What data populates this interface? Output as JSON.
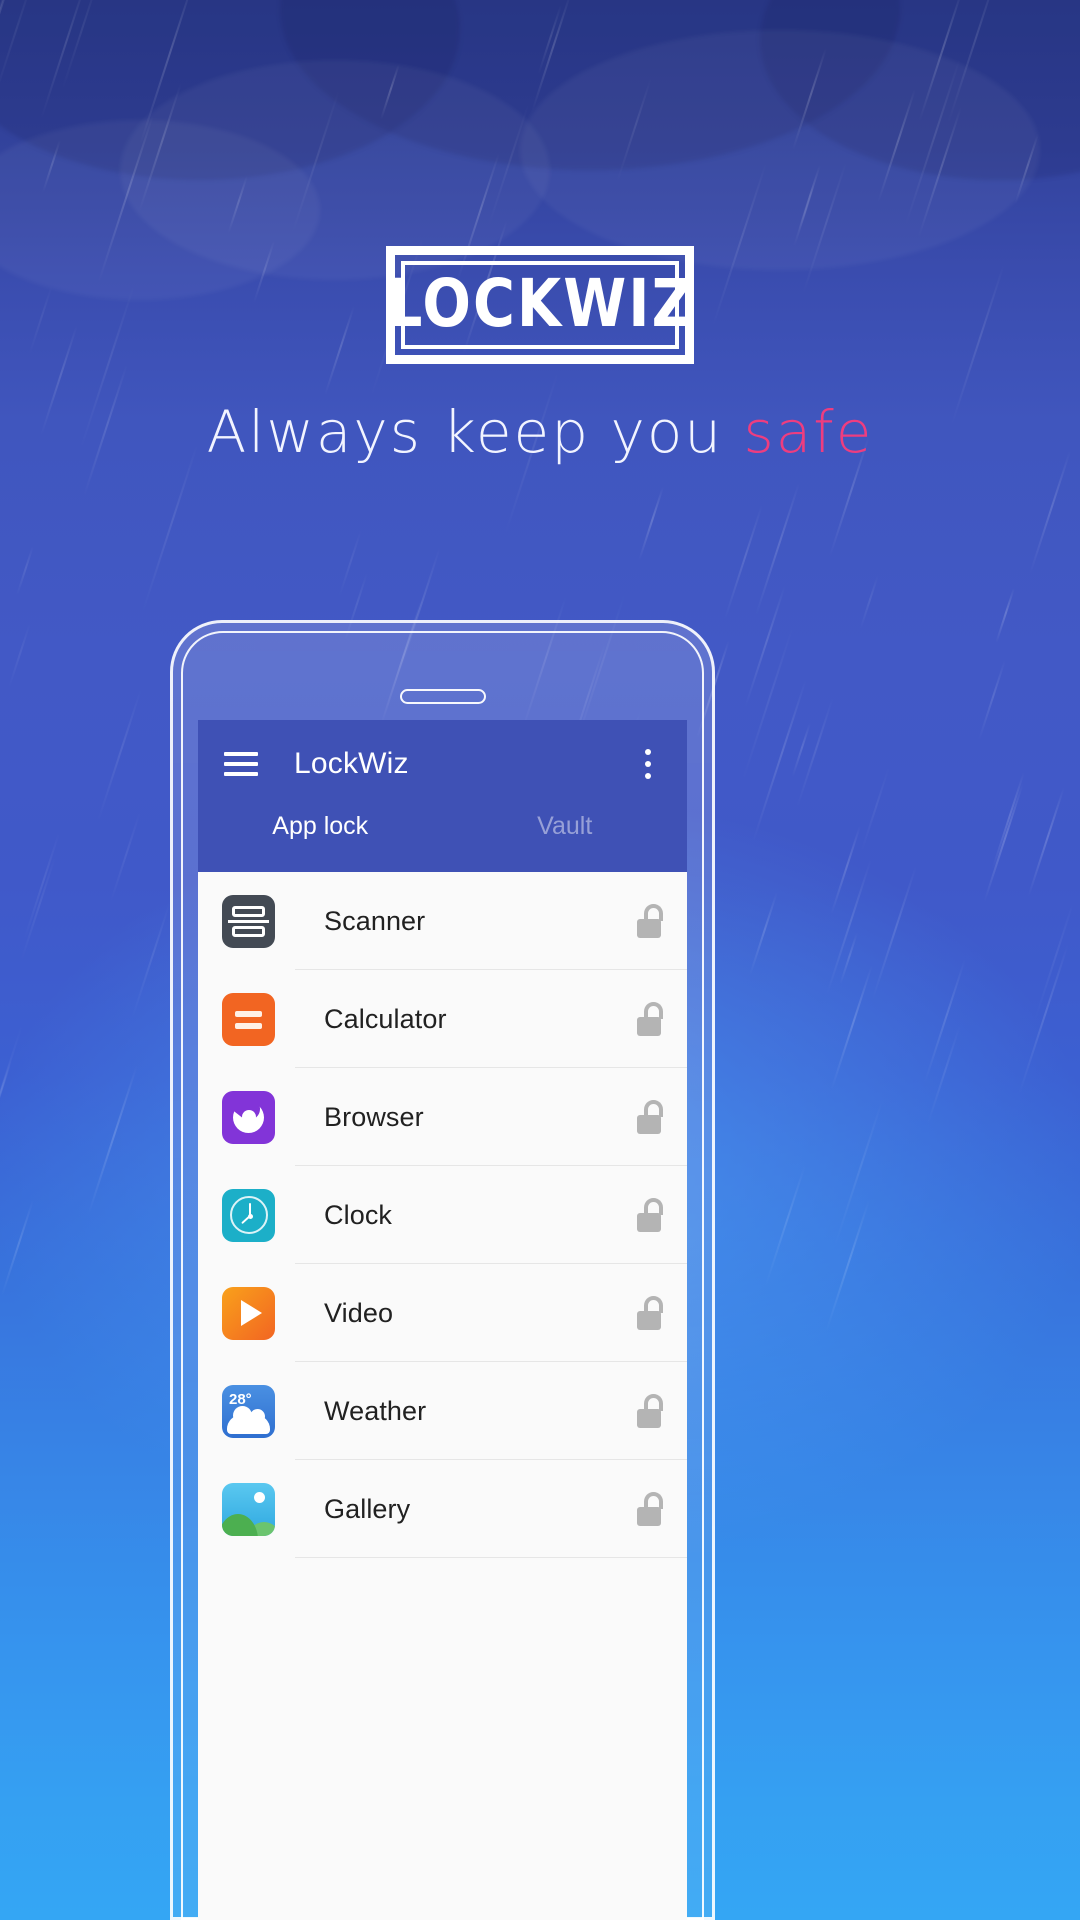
{
  "branding": {
    "logo_text": "LOCKWIZ",
    "tagline_prefix": "Always keep you ",
    "tagline_highlight": "safe",
    "highlight_color": "#EE3D7F"
  },
  "phone": {
    "appbar": {
      "title": "LockWiz",
      "menu_icon": "hamburger-icon",
      "overflow_icon": "more-vert-icon",
      "accent_color": "#3F51B5"
    },
    "tabs": [
      {
        "label": "App lock",
        "active": true
      },
      {
        "label": "Vault",
        "active": false
      }
    ],
    "list": {
      "lock_icon": "unlock-icon",
      "items": [
        {
          "label": "Scanner",
          "icon": "scanner-icon",
          "color": "#434A54",
          "locked": false
        },
        {
          "label": "Calculator",
          "icon": "calculator-icon",
          "color": "#F26522",
          "locked": false
        },
        {
          "label": "Browser",
          "icon": "browser-icon",
          "color": "#8234D8",
          "locked": false
        },
        {
          "label": "Clock",
          "icon": "clock-icon",
          "color": "#1CAFC8",
          "locked": false
        },
        {
          "label": "Video",
          "icon": "video-icon",
          "color": "#F7941E",
          "locked": false
        },
        {
          "label": "Weather",
          "icon": "weather-icon",
          "color": "#3B82D6",
          "locked": false,
          "temperature": "28°"
        },
        {
          "label": "Gallery",
          "icon": "gallery-icon",
          "color": "#4AC3E8",
          "locked": false
        }
      ]
    }
  }
}
